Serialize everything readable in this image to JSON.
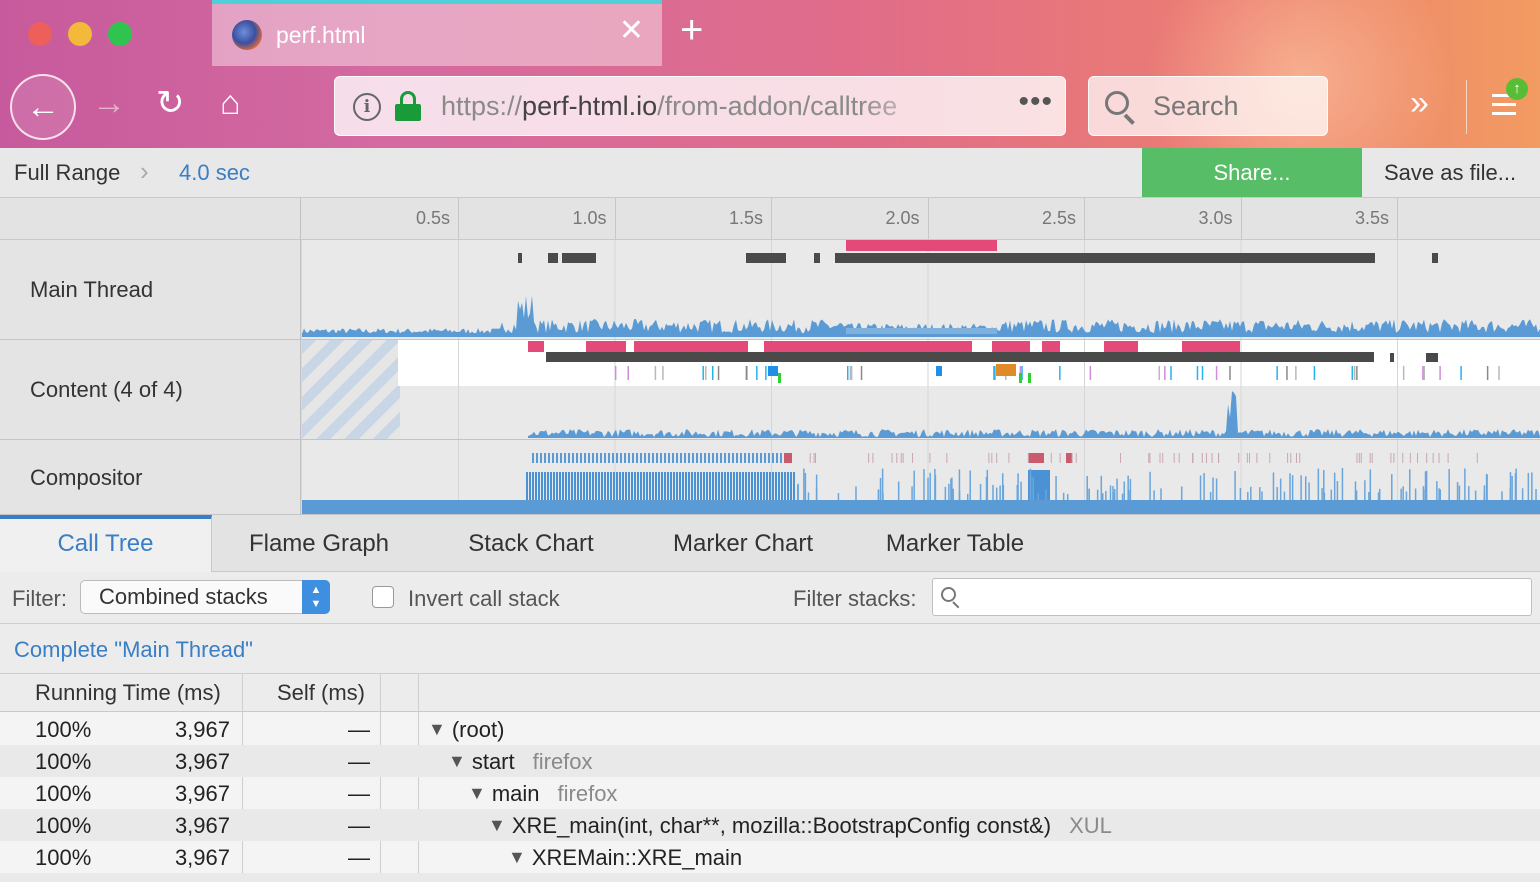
{
  "browser": {
    "tab_title": "perf.html",
    "tab_close": "✕",
    "new_tab": "+",
    "url_base": "https://",
    "url_host": "perf-html.io",
    "url_path": "/from-addon/calltree",
    "page_actions": "•••",
    "search_placeholder": "Search",
    "overflow": "»",
    "update_badge": "↑",
    "back": "←",
    "forward": "→",
    "reload": "↻",
    "home": "⌂",
    "info": "i"
  },
  "profile_header": {
    "full_range": "Full Range",
    "separator": "›",
    "range": "4.0 sec",
    "share": "Share...",
    "save": "Save as file..."
  },
  "timeline": {
    "ticks": [
      "0.5s",
      "1.0s",
      "1.5s",
      "2.0s",
      "2.5s",
      "3.0s",
      "3.5s"
    ],
    "tracks": [
      {
        "label": "Main Thread"
      },
      {
        "label": "Content (4 of 4)"
      },
      {
        "label": "Compositor"
      }
    ]
  },
  "panel_tabs": [
    "Call Tree",
    "Flame Graph",
    "Stack Chart",
    "Marker Chart",
    "Marker Table"
  ],
  "selected_tab": "Call Tree",
  "filter": {
    "label": "Filter:",
    "value": "Combined stacks",
    "invert_label": "Invert call stack",
    "invert_checked": false,
    "stacks_label": "Filter stacks:",
    "stacks_value": ""
  },
  "thread_title": "Complete \"Main Thread\"",
  "call_tree": {
    "headers": {
      "running": "Running Time (ms)",
      "self": "Self (ms)"
    },
    "rows": [
      {
        "pct": "100%",
        "ms": "3,967",
        "self": "—",
        "func": "(root)",
        "lib": ""
      },
      {
        "pct": "100%",
        "ms": "3,967",
        "self": "—",
        "func": "start",
        "lib": "firefox"
      },
      {
        "pct": "100%",
        "ms": "3,967",
        "self": "—",
        "func": "main",
        "lib": "firefox"
      },
      {
        "pct": "100%",
        "ms": "3,967",
        "self": "—",
        "func": "XRE_main(int, char**, mozilla::BootstrapConfig const&)",
        "lib": "XUL"
      },
      {
        "pct": "100%",
        "ms": "3,967",
        "self": "—",
        "func": "XREMain::XRE_main",
        "lib": ""
      }
    ]
  },
  "colors": {
    "accent": "#3a7ec5",
    "share": "#57bd67",
    "graph": "#5a9bd5",
    "marker_red": "#e34a79",
    "marker_dark": "#4a4a4a"
  }
}
